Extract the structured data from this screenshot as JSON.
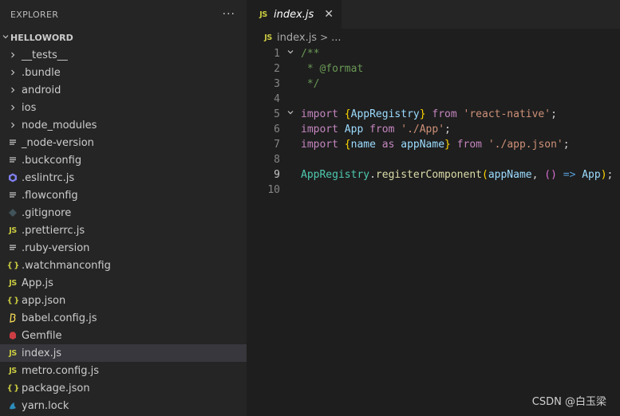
{
  "explorer": {
    "title": "EXPLORER",
    "more_actions": "···",
    "root_label": "HELLOWORD",
    "items": [
      {
        "label": "__tests__",
        "icon": "chevron-right-icon"
      },
      {
        "label": ".bundle",
        "icon": "chevron-right-icon"
      },
      {
        "label": "android",
        "icon": "chevron-right-icon"
      },
      {
        "label": "ios",
        "icon": "chevron-right-icon"
      },
      {
        "label": "node_modules",
        "icon": "chevron-right-icon"
      },
      {
        "label": "_node-version",
        "icon": "text-file-icon"
      },
      {
        "label": ".buckconfig",
        "icon": "text-file-icon"
      },
      {
        "label": ".eslintrc.js",
        "icon": "eslint-icon"
      },
      {
        "label": ".flowconfig",
        "icon": "text-file-icon"
      },
      {
        "label": ".gitignore",
        "icon": "git-icon"
      },
      {
        "label": ".prettierrc.js",
        "icon": "js-file-icon"
      },
      {
        "label": ".ruby-version",
        "icon": "text-file-icon"
      },
      {
        "label": ".watchmanconfig",
        "icon": "json-file-icon"
      },
      {
        "label": "App.js",
        "icon": "js-file-icon"
      },
      {
        "label": "app.json",
        "icon": "json-file-icon"
      },
      {
        "label": "babel.config.js",
        "icon": "babel-icon"
      },
      {
        "label": "Gemfile",
        "icon": "ruby-gem-icon"
      },
      {
        "label": "index.js",
        "icon": "js-file-icon"
      },
      {
        "label": "metro.config.js",
        "icon": "js-file-icon"
      },
      {
        "label": "package.json",
        "icon": "json-file-icon"
      },
      {
        "label": "yarn.lock",
        "icon": "yarn-icon"
      }
    ]
  },
  "icons": {
    "js": "JS",
    "json": "{ }"
  },
  "colors": {
    "sidebar_bg": "#252526",
    "editor_bg": "#1e1e1e",
    "active_row": "#37373d",
    "js_icon": "#cbcb41",
    "comment": "#6a9955",
    "keyword": "#c586c0",
    "string": "#ce9178"
  },
  "tab": {
    "label": "index.js",
    "close": "✕"
  },
  "breadcrumb": {
    "file": "index.js",
    "separator": ">",
    "more": "..."
  },
  "code": {
    "line_numbers": [
      "1",
      "2",
      "3",
      "4",
      "5",
      "6",
      "7",
      "8",
      "9",
      "10"
    ],
    "current_line": "9",
    "l1": "/**",
    "l2": " * @format",
    "l3": " */",
    "l5_import": "import",
    "l5_brace_open": "{",
    "l5_name": "AppRegistry",
    "l5_brace_close": "}",
    "l5_from": "from",
    "l5_str": "'react-native'",
    "l5_semi": ";",
    "l6_import": "import",
    "l6_name": "App",
    "l6_from": "from",
    "l6_str": "'./App'",
    "l6_semi": ";",
    "l7_import": "import",
    "l7_brace_open": "{",
    "l7_name": "name",
    "l7_as": "as",
    "l7_alias": "appName",
    "l7_brace_close": "}",
    "l7_from": "from",
    "l7_str": "'./app.json'",
    "l7_semi": ";",
    "l9_obj": "AppRegistry",
    "l9_dot": ".",
    "l9_fn": "registerComponent",
    "l9_paren_open": "(",
    "l9_arg": "appName",
    "l9_comma": ", ",
    "l9_parens": "()",
    "l9_arrow": "=>",
    "l9_ret": "App",
    "l9_paren_close": ")",
    "l9_semi": ";"
  },
  "watermark": "CSDN @白玉梁"
}
